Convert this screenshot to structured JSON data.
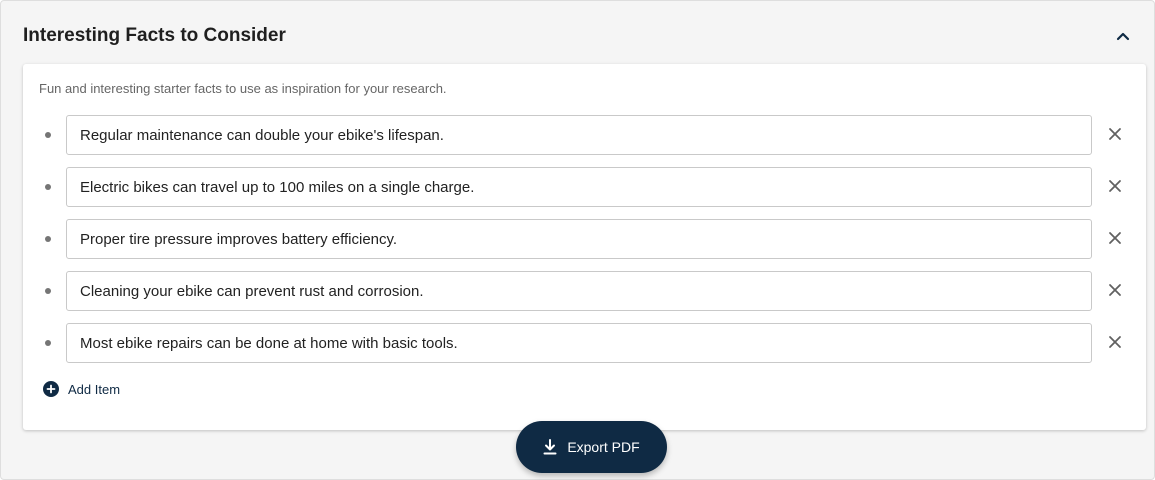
{
  "section": {
    "title": "Interesting Facts to Consider",
    "description": "Fun and interesting starter facts to use as inspiration for your research."
  },
  "facts": [
    "Regular maintenance can double your ebike's lifespan.",
    "Electric bikes can travel up to 100 miles on a single charge.",
    "Proper tire pressure improves battery efficiency.",
    "Cleaning your ebike can prevent rust and corrosion.",
    "Most ebike repairs can be done at home with basic tools."
  ],
  "actions": {
    "add_item_label": "Add Item",
    "export_label": "Export PDF"
  },
  "icons": {
    "collapse": "chevron-up-icon",
    "remove": "close-icon",
    "add": "plus-circle-icon",
    "export": "download-icon"
  },
  "colors": {
    "primary": "#0f2a44",
    "page_background": "#f5f5f5",
    "card_background": "#ffffff"
  }
}
